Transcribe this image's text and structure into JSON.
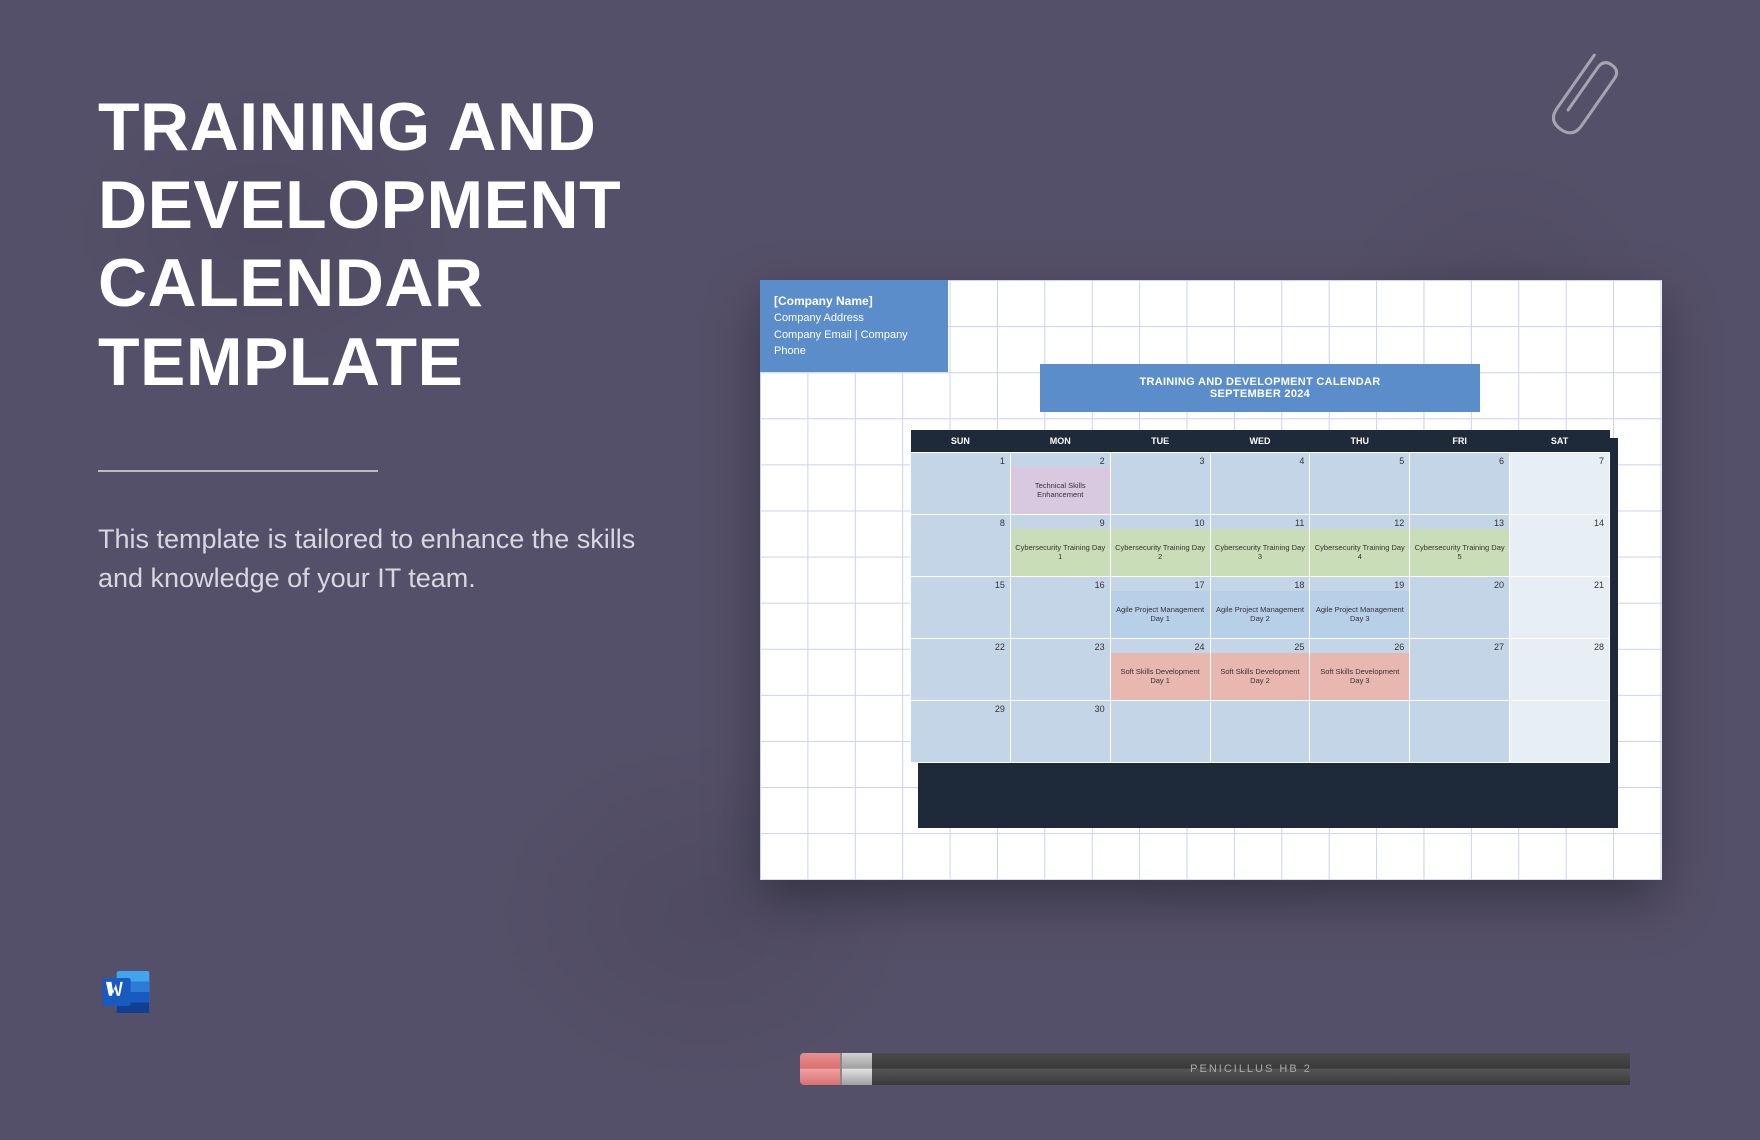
{
  "title_l1": "TRAINING AND",
  "title_l2": "DEVELOPMENT",
  "title_l3": "CALENDAR",
  "title_l4": "TEMPLATE",
  "description": "This template is tailored to enhance the skills and knowledge of your IT team.",
  "pencil_label": "PENICILLUS   HB 2",
  "company": {
    "name": "[Company Name]",
    "address": "Company Address",
    "contact": "Company Email | Company Phone"
  },
  "calendar_title_l1": "TRAINING AND DEVELOPMENT CALENDAR",
  "calendar_title_l2": "SEPTEMBER 2024",
  "days": [
    "SUN",
    "MON",
    "TUE",
    "WED",
    "THU",
    "FRI",
    "SAT"
  ],
  "weeks": [
    [
      {
        "n": "1"
      },
      {
        "n": "2",
        "ev": "Technical Skills Enhancement",
        "c": "purple"
      },
      {
        "n": "3"
      },
      {
        "n": "4"
      },
      {
        "n": "5"
      },
      {
        "n": "6"
      },
      {
        "n": "7"
      }
    ],
    [
      {
        "n": "8"
      },
      {
        "n": "9",
        "ev": "Cybersecurity Training Day 1",
        "c": "green"
      },
      {
        "n": "10",
        "ev": "Cybersecurity Training Day 2",
        "c": "green"
      },
      {
        "n": "11",
        "ev": "Cybersecurity Training Day 3",
        "c": "green"
      },
      {
        "n": "12",
        "ev": "Cybersecurity Training Day 4",
        "c": "green"
      },
      {
        "n": "13",
        "ev": "Cybersecurity Training Day 5",
        "c": "green"
      },
      {
        "n": "14"
      }
    ],
    [
      {
        "n": "15"
      },
      {
        "n": "16"
      },
      {
        "n": "17",
        "ev": "Agile Project Management Day 1",
        "c": "blue"
      },
      {
        "n": "18",
        "ev": "Agile Project Management Day 2",
        "c": "blue"
      },
      {
        "n": "19",
        "ev": "Agile Project Management Day 3",
        "c": "blue"
      },
      {
        "n": "20"
      },
      {
        "n": "21"
      }
    ],
    [
      {
        "n": "22"
      },
      {
        "n": "23"
      },
      {
        "n": "24",
        "ev": "Soft Skills Development Day 1",
        "c": "pink"
      },
      {
        "n": "25",
        "ev": "Soft Skills Development Day 2",
        "c": "pink"
      },
      {
        "n": "26",
        "ev": "Soft Skills Development Day 3",
        "c": "pink"
      },
      {
        "n": "27"
      },
      {
        "n": "28"
      }
    ],
    [
      {
        "n": "29"
      },
      {
        "n": "30"
      },
      {
        "n": ""
      },
      {
        "n": ""
      },
      {
        "n": ""
      },
      {
        "n": ""
      },
      {
        "n": ""
      }
    ]
  ]
}
